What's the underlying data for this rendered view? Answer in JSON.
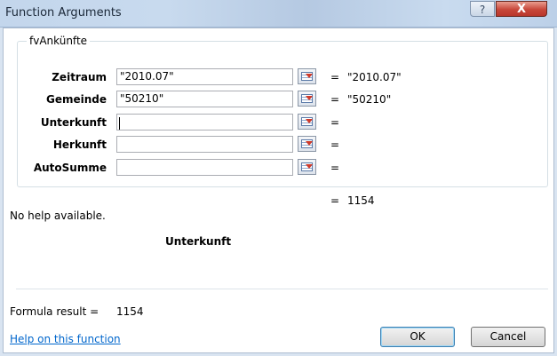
{
  "window": {
    "title": "Function Arguments",
    "help_glyph": "?",
    "close_glyph": "X"
  },
  "function": {
    "name": "fvAnkünfte",
    "overall_eq": "=",
    "overall_value": "1154",
    "help_text": "No help available.",
    "selected_arg": "Unterkunft"
  },
  "arguments": [
    {
      "label": "Zeitraum",
      "value": "\"2010.07\"",
      "eq": "=",
      "result": "\"2010.07\""
    },
    {
      "label": "Gemeinde",
      "value": "\"50210\"",
      "eq": "=",
      "result": "\"50210\""
    },
    {
      "label": "Unterkunft",
      "value": "",
      "eq": "=",
      "result": ""
    },
    {
      "label": "Herkunft",
      "value": "",
      "eq": "=",
      "result": ""
    },
    {
      "label": "AutoSumme",
      "value": "",
      "eq": "=",
      "result": ""
    }
  ],
  "footer": {
    "formula_result_label": "Formula result =",
    "formula_result_value": "1154",
    "help_link": "Help on this function",
    "ok_label": "OK",
    "cancel_label": "Cancel"
  },
  "icons": {
    "ref_button": "collapse-dialog-icon"
  }
}
